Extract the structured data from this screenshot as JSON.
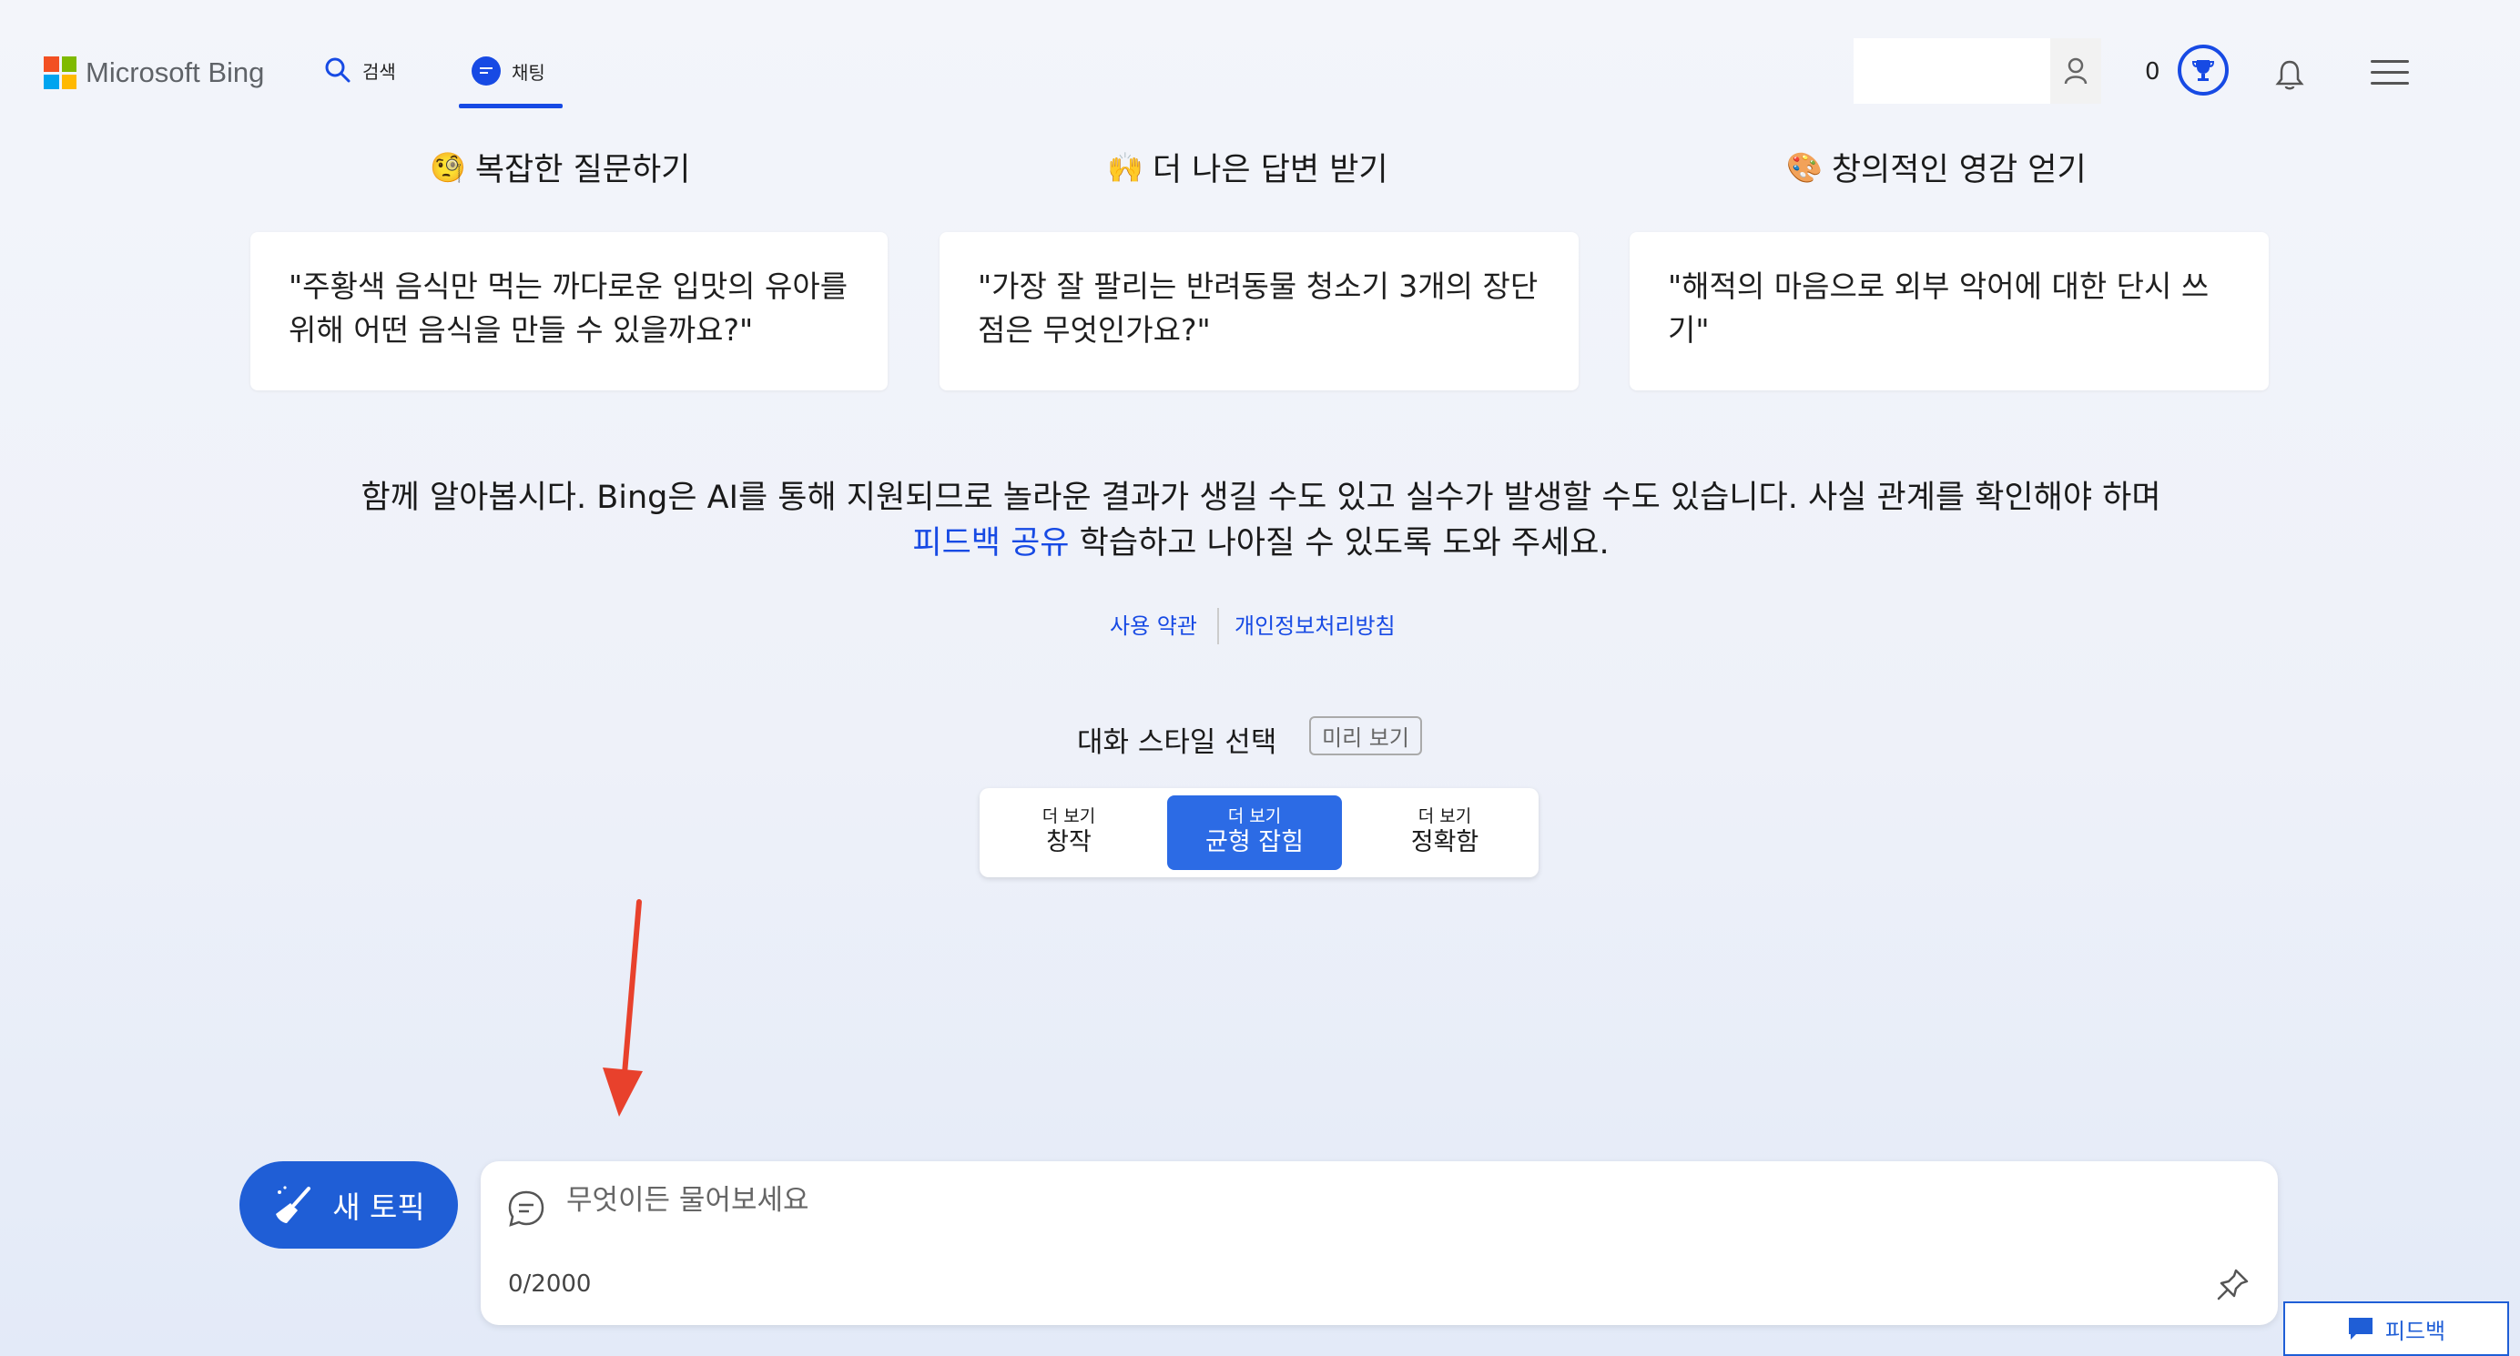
{
  "header": {
    "logo_text": "Microsoft Bing",
    "nav_search": "검색",
    "nav_chat": "채팅",
    "reward_count": "0"
  },
  "examples": [
    {
      "emoji": "🧐",
      "title": "복잡한 질문하기",
      "prompt": "\"주황색 음식만 먹는 까다로운 입맛의 유아를 위해 어떤 음식을 만들 수 있을까요?\""
    },
    {
      "emoji": "🙌",
      "title": "더 나은 답변 받기",
      "prompt": "\"가장 잘 팔리는 반려동물 청소기 3개의 장단점은 무엇인가요?\""
    },
    {
      "emoji": "🎨",
      "title": "창의적인 영감 얻기",
      "prompt": "\"해적의 마음으로 외부 악어에 대한 단시 쓰기\""
    }
  ],
  "disclaimer": {
    "before": "함께 알아봅시다. Bing은 AI를 통해 지원되므로 놀라운 결과가 생길 수도 있고 실수가 발생할 수도 있습니다. 사실 관계를 확인해야 하며 ",
    "link": "피드백 공유",
    "after": " 학습하고 나아질 수 있도록 도와 주세요."
  },
  "legal": {
    "terms": "사용 약관",
    "privacy": "개인정보처리방침"
  },
  "conversation_style": {
    "label": "대화 스타일 선택",
    "badge": "미리 보기",
    "options": [
      {
        "small": "더 보기",
        "big": "창작",
        "selected": false
      },
      {
        "small": "더 보기",
        "big": "균형 잡힘",
        "selected": true
      },
      {
        "small": "더 보기",
        "big": "정확함",
        "selected": false
      }
    ]
  },
  "composer": {
    "new_topic": "새 토픽",
    "placeholder": "무엇이든 물어보세요",
    "counter": "0/2000"
  },
  "feedback_label": "피드백",
  "colors": {
    "accent": "#174ae4",
    "new_topic_bg": "#1f5ed6",
    "annotation_arrow": "#e8412c"
  }
}
